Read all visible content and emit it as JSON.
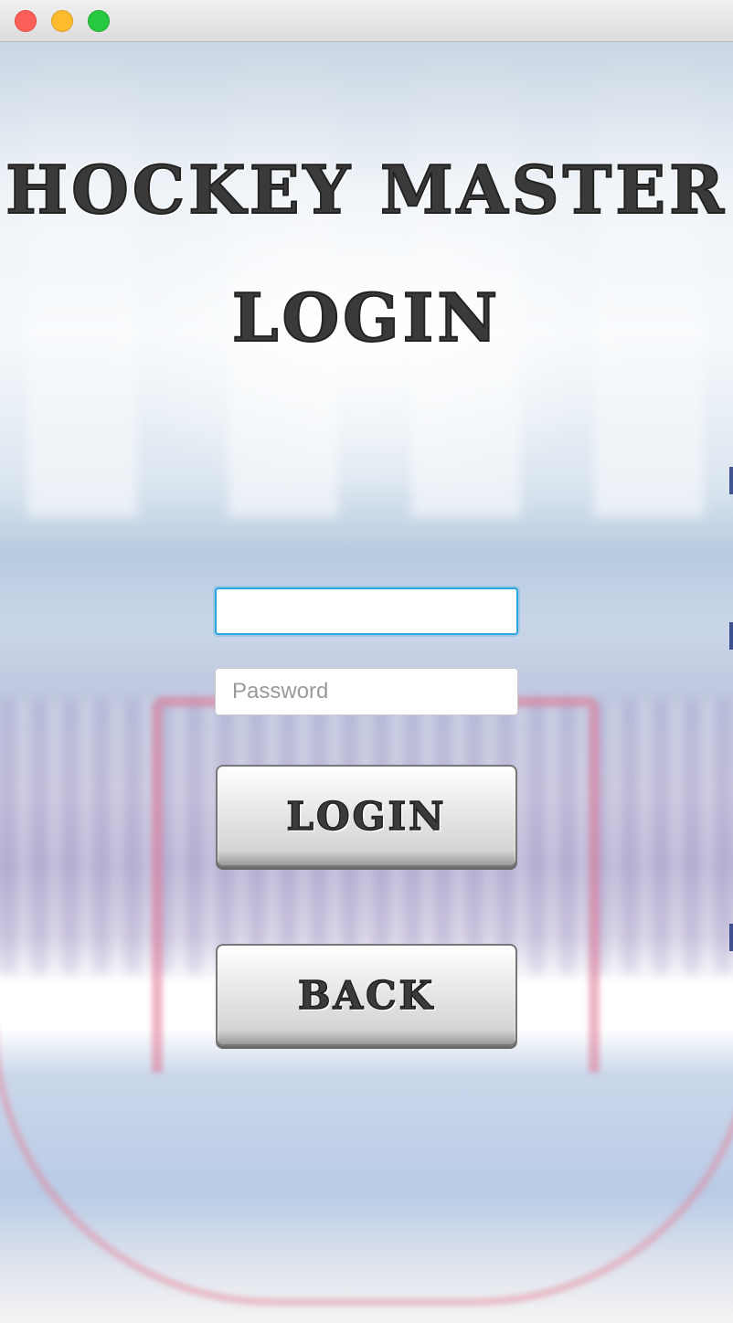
{
  "window": {
    "controls": [
      "close",
      "minimize",
      "maximize"
    ]
  },
  "screen": {
    "title": "HOCKEY MASTER",
    "subtitle": "LOGIN"
  },
  "form": {
    "username_value": "",
    "username_placeholder": "",
    "password_value": "",
    "password_placeholder": "Password",
    "login_label": "LOGIN",
    "back_label": "BACK"
  },
  "colors": {
    "focus_ring": "#2ba6de",
    "close": "#fc5f57",
    "minimize": "#fdbc2e",
    "maximize": "#28c840"
  }
}
